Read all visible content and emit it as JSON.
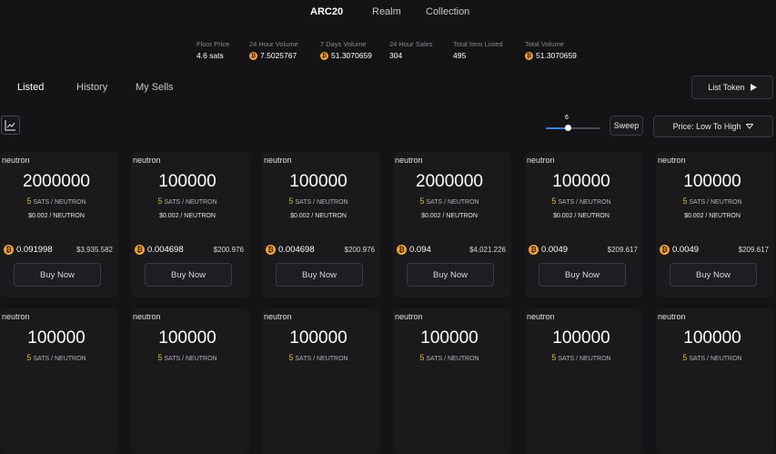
{
  "top_tabs": [
    {
      "label": "ARC20",
      "active": true
    },
    {
      "label": "Realm",
      "active": false
    },
    {
      "label": "Collection",
      "active": false
    }
  ],
  "stats": [
    {
      "label": "Floor Price",
      "value": "4.6 sats",
      "btc": false
    },
    {
      "label": "24 Hour Volume",
      "value": "7.5025767",
      "btc": true
    },
    {
      "label": "7 Days Volume",
      "value": "51.3070659",
      "btc": true
    },
    {
      "label": "24 Hour Sales",
      "value": "304",
      "btc": false
    },
    {
      "label": "Total Item Listed",
      "value": "495",
      "btc": false
    },
    {
      "label": "Total Volume",
      "value": "51.3070659",
      "btc": true
    }
  ],
  "sub_tabs": [
    {
      "label": "Listed",
      "active": true
    },
    {
      "label": "History",
      "active": false
    },
    {
      "label": "My Sells",
      "active": false
    }
  ],
  "list_token_label": "List Token",
  "sweep": {
    "value": "6",
    "level": 0.4,
    "button_label": "Sweep"
  },
  "sort_label": "Price: Low To High",
  "icons": {
    "coin": "bitcoin-icon",
    "chart": "chart-icon",
    "play": "play-icon",
    "chevron": "chevron-down-icon"
  },
  "colors": {
    "background": "#141416",
    "card": "#1a1a1d",
    "btc": "#f2a33a",
    "sats_highlight": "#d8b62a",
    "slider": "#3b82f6"
  },
  "cards": [
    {
      "name": "neutron",
      "amount": "2000000",
      "sats_num": "5",
      "sats_unit": "SATS / NEUTRON",
      "usd": "$0.002 / NEUTRON",
      "price": "0.091998",
      "total": "$3,935.582",
      "buy_label": "Buy Now"
    },
    {
      "name": "neutron",
      "amount": "100000",
      "sats_num": "5",
      "sats_unit": "SATS / NEUTRON",
      "usd": "$0.002 / NEUTRON",
      "price": "0.004698",
      "total": "$200.976",
      "buy_label": "Buy Now"
    },
    {
      "name": "neutron",
      "amount": "100000",
      "sats_num": "5",
      "sats_unit": "SATS / NEUTRON",
      "usd": "$0.002 / NEUTRON",
      "price": "0.004698",
      "total": "$200.976",
      "buy_label": "Buy Now"
    },
    {
      "name": "neutron",
      "amount": "2000000",
      "sats_num": "5",
      "sats_unit": "SATS / NEUTRON",
      "usd": "$0.002 / NEUTRON",
      "price": "0.094",
      "total": "$4,021.226",
      "buy_label": "Buy Now"
    },
    {
      "name": "neutron",
      "amount": "100000",
      "sats_num": "5",
      "sats_unit": "SATS / NEUTRON",
      "usd": "$0.002 / NEUTRON",
      "price": "0.0049",
      "total": "$209.617",
      "buy_label": "Buy Now"
    },
    {
      "name": "neutron",
      "amount": "100000",
      "sats_num": "5",
      "sats_unit": "SATS / NEUTRON",
      "usd": "$0.002 / NEUTRON",
      "price": "0.0049",
      "total": "$209.617",
      "buy_label": "Buy Now"
    },
    {
      "name": "neutron",
      "amount": "100000",
      "sats_num": "5",
      "sats_unit": "SATS / NEUTRON"
    },
    {
      "name": "neutron",
      "amount": "100000",
      "sats_num": "5",
      "sats_unit": "SATS / NEUTRON"
    },
    {
      "name": "neutron",
      "amount": "100000",
      "sats_num": "5",
      "sats_unit": "SATS / NEUTRON"
    },
    {
      "name": "neutron",
      "amount": "100000",
      "sats_num": "5",
      "sats_unit": "SATS / NEUTRON"
    },
    {
      "name": "neutron",
      "amount": "100000",
      "sats_num": "5",
      "sats_unit": "SATS / NEUTRON"
    },
    {
      "name": "neutron",
      "amount": "100000",
      "sats_num": "5",
      "sats_unit": "SATS / NEUTRON"
    }
  ]
}
